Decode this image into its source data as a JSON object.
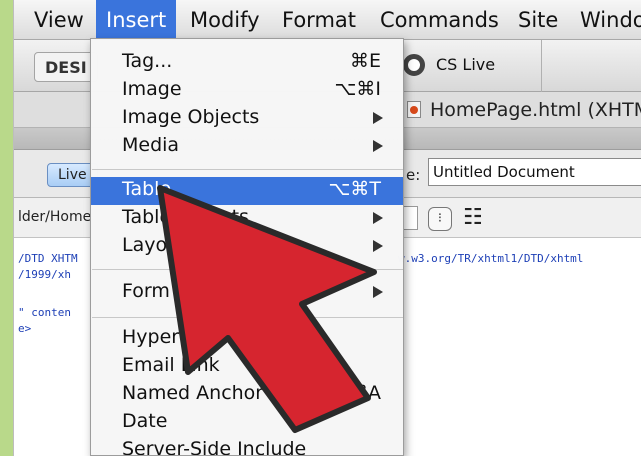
{
  "menubar": {
    "items": [
      "View",
      "Insert",
      "Modify",
      "Format",
      "Commands",
      "Site",
      "Windo"
    ]
  },
  "toolbar": {
    "design_label": "DESI",
    "cslive_label": "CS Live"
  },
  "document": {
    "file_tab": "HomePage.html (XHTM",
    "live_label": "Live",
    "title_label": "e:",
    "title_value": "Untitled Document",
    "address_text": "lder/Home",
    "options_glyph": "⁝",
    "view_options_glyph": "☷"
  },
  "code": {
    "lines": [
      "/DTD XHTM",
      "/1999/xh",
      "\" conten",
      "e>",
      "w.w3.org/TR/xhtml1/DTD/xhtml"
    ]
  },
  "insert_menu": {
    "items": [
      {
        "label": "Tag...",
        "shortcut": "⌘E"
      },
      {
        "label": "Image",
        "shortcut": "⌥⌘I"
      },
      {
        "label": "Image Objects",
        "submenu": true
      },
      {
        "label": "Media",
        "submenu": true
      },
      {
        "label": "Table",
        "shortcut": "⌥⌘T",
        "highlighted": true
      },
      {
        "label": "Table Objects",
        "submenu": true
      },
      {
        "label": "Layout Objects",
        "submenu": true
      },
      {
        "label": "Form",
        "submenu": true
      },
      {
        "label": "Hyperlink"
      },
      {
        "label": "Email Link"
      },
      {
        "label": "Named Anchor",
        "shortcut": "⌥⌘A"
      },
      {
        "label": "Date"
      },
      {
        "label": "Server-Side Include"
      }
    ]
  },
  "colors": {
    "menu_highlight": "#3a74dc",
    "pointer_arrow": "#d6252f",
    "edge_strip": "#b9d98a"
  }
}
